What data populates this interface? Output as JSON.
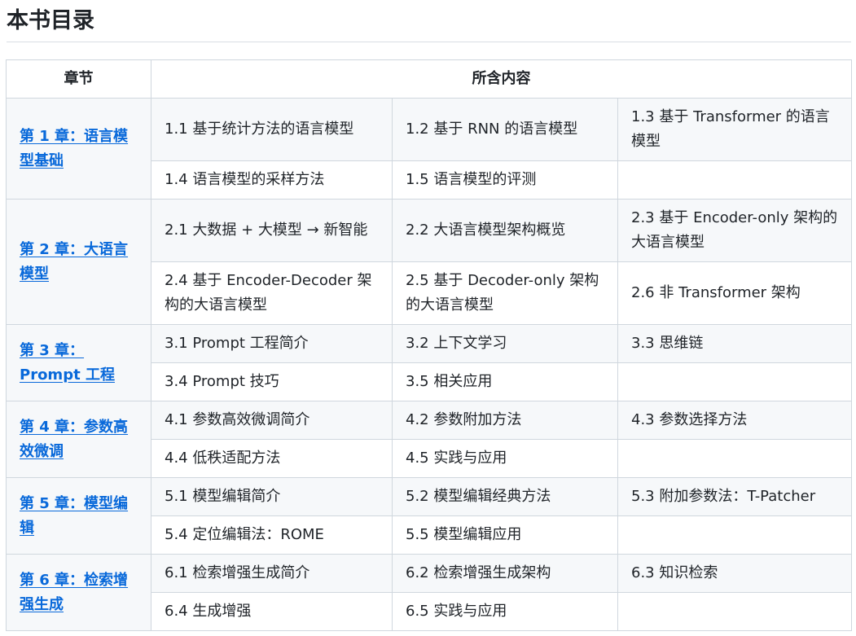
{
  "page_title": "本书目录",
  "table": {
    "headers": {
      "chapter": "章节",
      "contents": "所含内容"
    },
    "chapters": [
      {
        "title": "第 1 章：语言模型基础",
        "rows": [
          [
            "1.1 基于统计方法的语言模型",
            "1.2 基于 RNN 的语言模型",
            "1.3 基于 Transformer 的语言模型"
          ],
          [
            "1.4 语言模型的采样方法",
            "1.5 语言模型的评测",
            ""
          ]
        ]
      },
      {
        "title": "第 2 章：大语言模型",
        "rows": [
          [
            "2.1 大数据 + 大模型 → 新智能",
            "2.2 大语言模型架构概览",
            "2.3 基于 Encoder-only 架构的大语言模型"
          ],
          [
            "2.4 基于 Encoder-Decoder 架构的大语言模型",
            "2.5 基于 Decoder-only 架构的大语言模型",
            "2.6 非 Transformer 架构"
          ]
        ]
      },
      {
        "title": "第 3 章：Prompt 工程",
        "rows": [
          [
            "3.1 Prompt 工程简介",
            "3.2 上下文学习",
            "3.3 思维链"
          ],
          [
            "3.4 Prompt 技巧",
            "3.5 相关应用",
            ""
          ]
        ]
      },
      {
        "title": "第 4 章：参数高效微调",
        "rows": [
          [
            "4.1 参数高效微调简介",
            "4.2 参数附加方法",
            "4.3 参数选择方法"
          ],
          [
            "4.4 低秩适配方法",
            "4.5 实践与应用",
            ""
          ]
        ]
      },
      {
        "title": "第 5 章：模型编辑",
        "rows": [
          [
            "5.1 模型编辑简介",
            "5.2 模型编辑经典方法",
            "5.3 附加参数法：T-Patcher"
          ],
          [
            "5.4 定位编辑法：ROME",
            "5.5 模型编辑应用",
            ""
          ]
        ]
      },
      {
        "title": "第 6 章：检索增强生成",
        "rows": [
          [
            "6.1 检索增强生成简介",
            "6.2 检索增强生成架构",
            "6.3 知识检索"
          ],
          [
            "6.4 生成增强",
            "6.5 实践与应用",
            ""
          ]
        ]
      }
    ]
  }
}
